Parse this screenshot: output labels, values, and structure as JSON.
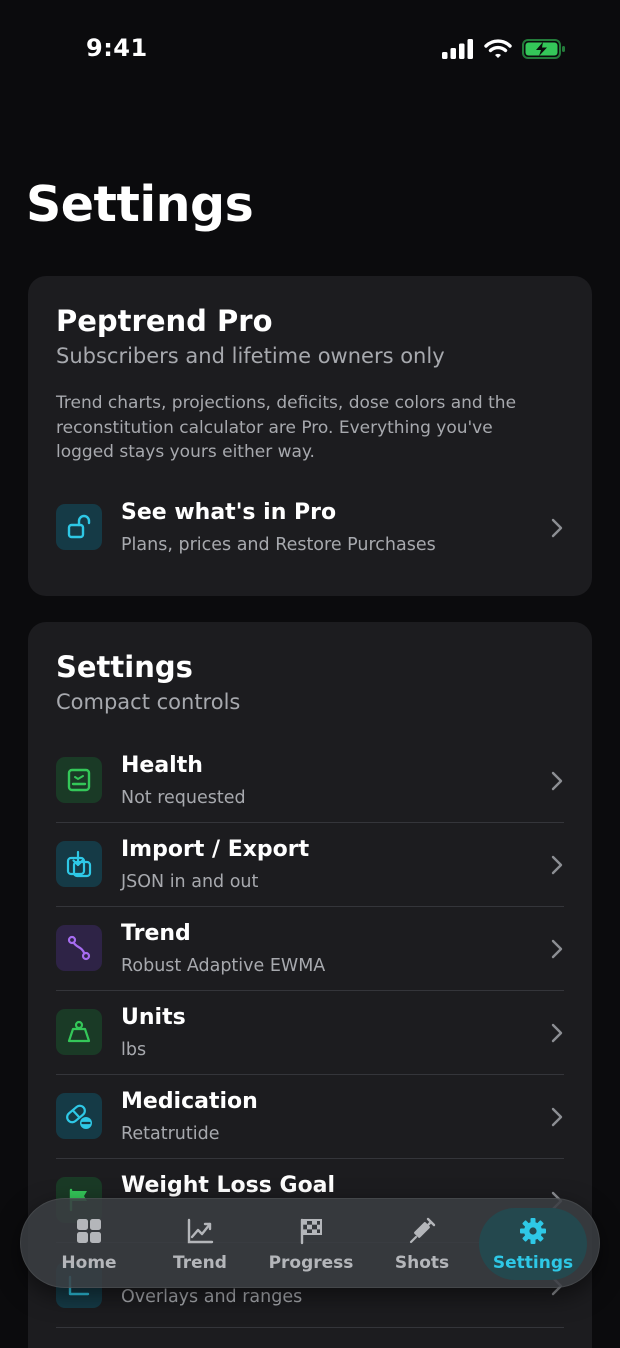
{
  "status_bar": {
    "time": "9:41"
  },
  "page": {
    "title": "Settings"
  },
  "pro_card": {
    "title": "Peptrend Pro",
    "subtitle": "Subscribers and lifetime owners only",
    "body_lines": [
      "Trend charts, projections, deficits, dose colors and the",
      "reconstitution calculator are Pro. Everything you've",
      "logged stays yours either way."
    ],
    "row": {
      "title": "See what's in Pro",
      "subtitle": "Plans, prices and Restore Purchases",
      "icon": "unlock-icon"
    }
  },
  "settings_card": {
    "title": "Settings",
    "subtitle": "Compact controls",
    "rows": [
      {
        "title": "Health",
        "subtitle": "Not requested",
        "icon": "health-record-icon",
        "color": "#34c759"
      },
      {
        "title": "Import / Export",
        "subtitle": "JSON in and out",
        "icon": "import-export-icon",
        "color": "#2ec8e6"
      },
      {
        "title": "Trend",
        "subtitle": "Robust Adaptive EWMA",
        "icon": "trend-path-icon",
        "color": "#a66cf0"
      },
      {
        "title": "Units",
        "subtitle": "lbs",
        "icon": "weight-icon",
        "color": "#34c759"
      },
      {
        "title": "Medication",
        "subtitle": "Retatrutide",
        "icon": "pill-icon",
        "color": "#2ec8e6"
      },
      {
        "title": "Weight Loss Goal",
        "subtitle": "",
        "icon": "flag-icon",
        "color": "#34c759"
      },
      {
        "title": "",
        "subtitle": "Overlays and ranges",
        "icon": "overlay-icon",
        "color": "#2ec8e6"
      }
    ]
  },
  "tab_bar": {
    "tabs": [
      {
        "label": "Home",
        "icon": "grid-icon",
        "active": false
      },
      {
        "label": "Trend",
        "icon": "chart-icon",
        "active": false
      },
      {
        "label": "Progress",
        "icon": "checkered-flag-icon",
        "active": false
      },
      {
        "label": "Shots",
        "icon": "syringe-icon",
        "active": false
      },
      {
        "label": "Settings",
        "icon": "gear-icon",
        "active": true
      }
    ],
    "active_color": "#2ec8e6"
  }
}
